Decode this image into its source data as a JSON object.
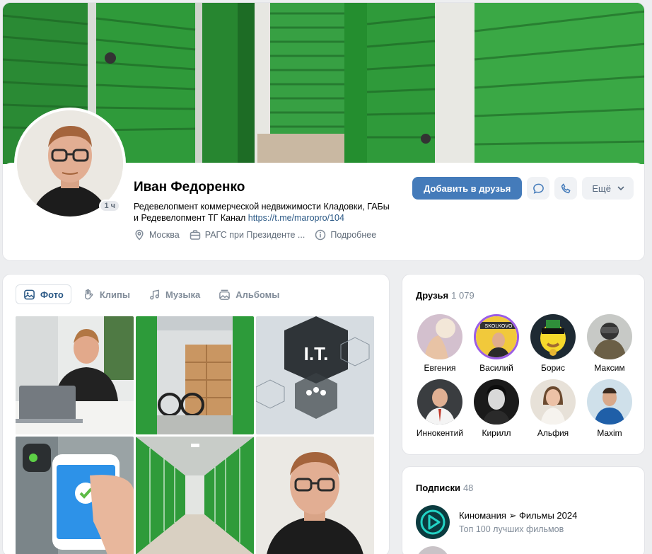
{
  "profile": {
    "name": "Иван Федоренко",
    "online_badge": "1 ч",
    "status_text": "Редевелопмент коммерческой недвижимости Кладовки, ГАБы и Редевелопмент ТГ Канал ",
    "status_link": "https://t.me/maropro/104",
    "meta": {
      "city": "Москва",
      "education": "РАГС при Президенте ...",
      "more": "Подробнее"
    },
    "actions": {
      "add_friend": "Добавить в друзья",
      "more": "Ещё"
    }
  },
  "media": {
    "tabs": [
      {
        "label": "Фото",
        "active": true
      },
      {
        "label": "Клипы",
        "active": false
      },
      {
        "label": "Музыка",
        "active": false
      },
      {
        "label": "Альбомы",
        "active": false
      }
    ],
    "photo_overlay_text": "I.T."
  },
  "friends": {
    "title": "Друзья",
    "count": "1 079",
    "list": [
      "Евгения",
      "Василий",
      "Борис",
      "Максим",
      "Иннокентий",
      "Кирилл",
      "Альфия",
      "Maxim"
    ],
    "badge_text": "SKOLKOVO"
  },
  "subscriptions": {
    "title": "Подписки",
    "count": "48",
    "items": [
      {
        "title": "Киномания ➢ Фильмы 2024",
        "desc": "Топ 100 лучших фильмов"
      }
    ]
  },
  "colors": {
    "primary_button": "#447bba",
    "link": "#2a5885",
    "muted": "#818c99",
    "storage_green": "#2e8b3a"
  }
}
